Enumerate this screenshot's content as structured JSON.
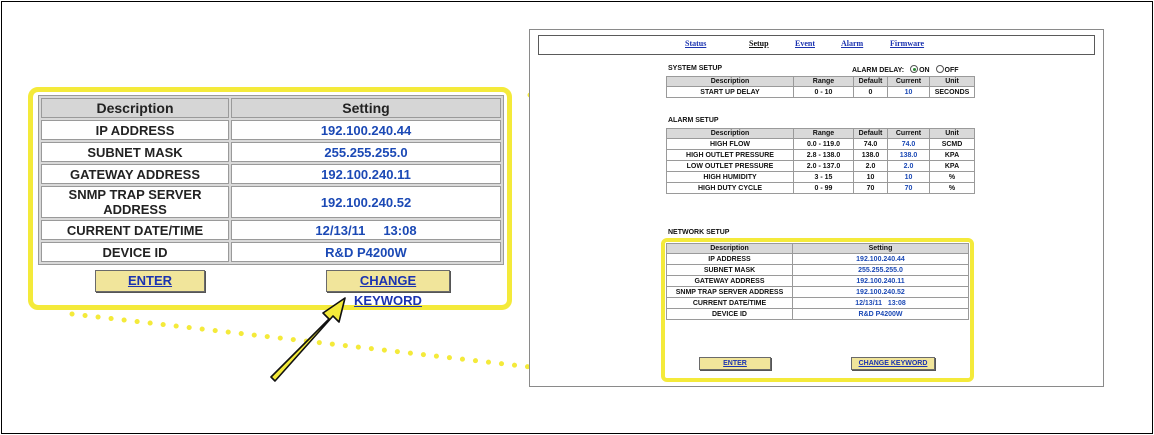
{
  "zoom": {
    "headers": {
      "description": "Description",
      "setting": "Setting"
    },
    "rows": [
      {
        "label": "IP ADDRESS",
        "value": "192.100.240.44"
      },
      {
        "label": "SUBNET MASK",
        "value": "255.255.255.0"
      },
      {
        "label": "GATEWAY ADDRESS",
        "value": "192.100.240.11"
      },
      {
        "label": "SNMP TRAP SERVER ADDRESS",
        "value": "192.100.240.52"
      },
      {
        "label": "CURRENT DATE/TIME",
        "date": "12/13/11",
        "time": "13:08"
      },
      {
        "label": "DEVICE ID",
        "value": "R&D P4200W"
      }
    ],
    "enter_label": "ENTER",
    "change_keyword_label": "CHANGE KEYWORD"
  },
  "screenshot": {
    "nav": [
      "Status",
      "Setup",
      "Event",
      "Alarm",
      "Firmware"
    ],
    "system_setup": {
      "title": "SYSTEM SETUP",
      "alarm_delay_label": "ALARM DELAY:",
      "on_label": "ON",
      "off_label": "OFF",
      "headers": [
        "Description",
        "Range",
        "Default",
        "Current",
        "Unit"
      ],
      "rows": [
        {
          "description": "START UP DELAY",
          "range": "0 - 10",
          "default": "0",
          "current": "10",
          "unit": "SECONDS"
        }
      ]
    },
    "alarm_setup": {
      "title": "ALARM SETUP",
      "headers": [
        "Description",
        "Range",
        "Default",
        "Current",
        "Unit"
      ],
      "rows": [
        {
          "description": "HIGH FLOW",
          "range": "0.0 - 119.0",
          "default": "74.0",
          "current": "74.0",
          "unit": "SCMD"
        },
        {
          "description": "HIGH OUTLET PRESSURE",
          "range": "2.8 - 138.0",
          "default": "138.0",
          "current": "138.0",
          "unit": "KPA"
        },
        {
          "description": "LOW OUTLET PRESSURE",
          "range": "2.0 - 137.0",
          "default": "2.0",
          "current": "2.0",
          "unit": "KPA"
        },
        {
          "description": "HIGH HUMIDITY",
          "range": "3 - 15",
          "default": "10",
          "current": "10",
          "unit": "%"
        },
        {
          "description": "HIGH DUTY CYCLE",
          "range": "0 - 99",
          "default": "70",
          "current": "70",
          "unit": "%"
        }
      ]
    },
    "network_setup": {
      "title": "NETWORK SETUP",
      "headers": [
        "Description",
        "Setting"
      ],
      "rows": [
        {
          "description": "IP ADDRESS",
          "setting": "192.100.240.44"
        },
        {
          "description": "SUBNET MASK",
          "setting": "255.255.255.0"
        },
        {
          "description": "GATEWAY ADDRESS",
          "setting": "192.100.240.11"
        },
        {
          "description": "SNMP TRAP SERVER ADDRESS",
          "setting": "192.100.240.52"
        },
        {
          "description": "CURRENT DATE/TIME",
          "setting": "12/13/11   13:08"
        },
        {
          "description": "DEVICE ID",
          "setting": "R&D P4200W"
        }
      ],
      "enter_label": "ENTER",
      "change_keyword_label": "CHANGE KEYWORD"
    }
  },
  "colors": {
    "highlight": "#f4ea3a",
    "link": "#1b33b0",
    "value_blue": "#1b49b5",
    "button_fill": "#f1e59b"
  }
}
